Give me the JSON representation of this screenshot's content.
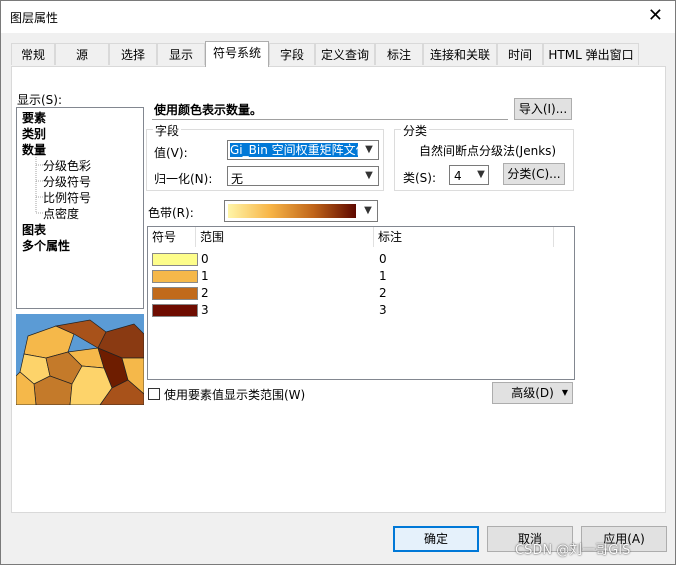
{
  "window": {
    "title": "图层属性",
    "close_glyph": "✕"
  },
  "tabs": [
    "常规",
    "源",
    "选择",
    "显示",
    "符号系统",
    "字段",
    "定义查询",
    "标注",
    "连接和关联",
    "时间",
    "HTML 弹出窗口"
  ],
  "active_tab": "符号系统",
  "show": {
    "label": "显示(S):",
    "items": [
      {
        "label": "要素",
        "bold": true,
        "indent": 0
      },
      {
        "label": "类别",
        "bold": true,
        "indent": 0
      },
      {
        "label": "数量",
        "bold": true,
        "indent": 0
      },
      {
        "label": "分级色彩",
        "bold": false,
        "indent": 1
      },
      {
        "label": "分级符号",
        "bold": false,
        "indent": 1
      },
      {
        "label": "比例符号",
        "bold": false,
        "indent": 1
      },
      {
        "label": "点密度",
        "bold": false,
        "indent": 1
      },
      {
        "label": "图表",
        "bold": true,
        "indent": 0
      },
      {
        "label": "多个属性",
        "bold": true,
        "indent": 0
      }
    ]
  },
  "description": "使用颜色表示数量。",
  "import_button": "导入(I)...",
  "fields": {
    "group_label": "字段",
    "value_label": "值(V):",
    "value": "Gi_Bin 空间权重矩阵文件",
    "normalize_label": "归一化(N):",
    "normalize_value": "无"
  },
  "classification": {
    "group_label": "分类",
    "method": "自然间断点分级法(Jenks)",
    "classes_label": "类(S):",
    "classes_value": "4",
    "classify_button": "分类(C)..."
  },
  "color_ramp": {
    "label": "色带(R):"
  },
  "table": {
    "headers": [
      "符号",
      "范围",
      "标注"
    ],
    "rows": [
      {
        "color": "#fdfd8a",
        "range": "0",
        "label": "0"
      },
      {
        "color": "#f5b84a",
        "range": "1",
        "label": "1"
      },
      {
        "color": "#c16a1b",
        "range": "2",
        "label": "2"
      },
      {
        "color": "#6e0c00",
        "range": "3",
        "label": "3"
      }
    ]
  },
  "show_values_checkbox": "使用要素值显示类范围(W)",
  "advanced_button": "高级(D)",
  "buttons": {
    "ok": "确定",
    "cancel": "取消",
    "apply": "应用(A)"
  },
  "watermark": "CSDN @刘一哥GIS"
}
